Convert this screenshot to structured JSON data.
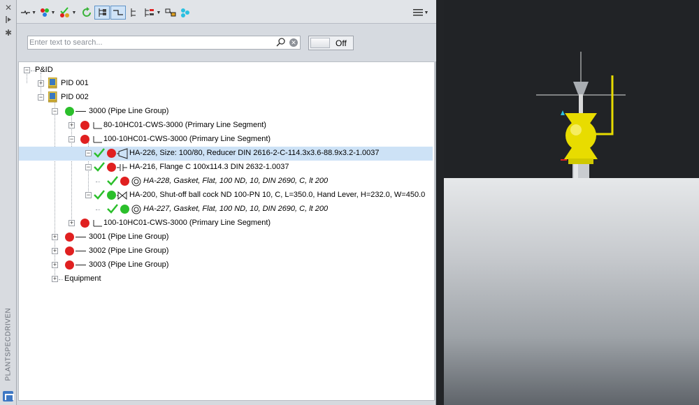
{
  "side_strip": {
    "label": "PLANTSPECDRIVEN",
    "buttons": [
      "close-icon",
      "pin-icon",
      "settings-icon"
    ]
  },
  "toolbar": {
    "tools": [
      "line-tool",
      "color-filter",
      "validate-filter",
      "refresh",
      "hierarchy-view",
      "line-view",
      "tree-view",
      "sort-dropdown",
      "link-tool",
      "network-tool"
    ],
    "menu_icon": "hamburger-menu-icon"
  },
  "search": {
    "placeholder": "Enter text to search...",
    "value": ""
  },
  "toggle": {
    "label": "Off"
  },
  "tree": {
    "root": "P&ID",
    "pid001": "PID 001",
    "pid002": "PID 002",
    "g3000": "3000 (Pipe Line Group)",
    "seg1": "80-10HC01-CWS-3000 (Primary Line Segment)",
    "seg2": "100-10HC01-CWS-3000 (Primary Line Segment)",
    "ha226": "HA-226, Size: 100/80, Reducer DIN 2616-2-C-114.3x3.6-88.9x3.2-1.0037",
    "ha216": "HA-216, Flange C 100x114.3 DIN 2632-1.0037",
    "ha228": "HA-228, Gasket, Flat, 100 ND, 10, DIN 2690, C, lt 200",
    "ha200": "HA-200, Shut-off ball cock ND 100-PN 10, C, L=350.0, Hand Lever, H=232.0, W=450.0",
    "ha227": "HA-227, Gasket, Flat, 100 ND, 10, DIN 2690, C, lt 200",
    "seg3": "100-10HC01-CWS-3000 (Primary Line Segment)",
    "g3001": "3001 (Pipe Line Group)",
    "g3002": "3002 (Pipe Line Group)",
    "g3003": "3003 (Pipe Line Group)",
    "equipment": "Equipment"
  },
  "colors": {
    "status_red": "#e02020",
    "status_green": "#2bbf2b",
    "selection": "#cde2f6",
    "valve_yellow": "#e8dc00"
  }
}
